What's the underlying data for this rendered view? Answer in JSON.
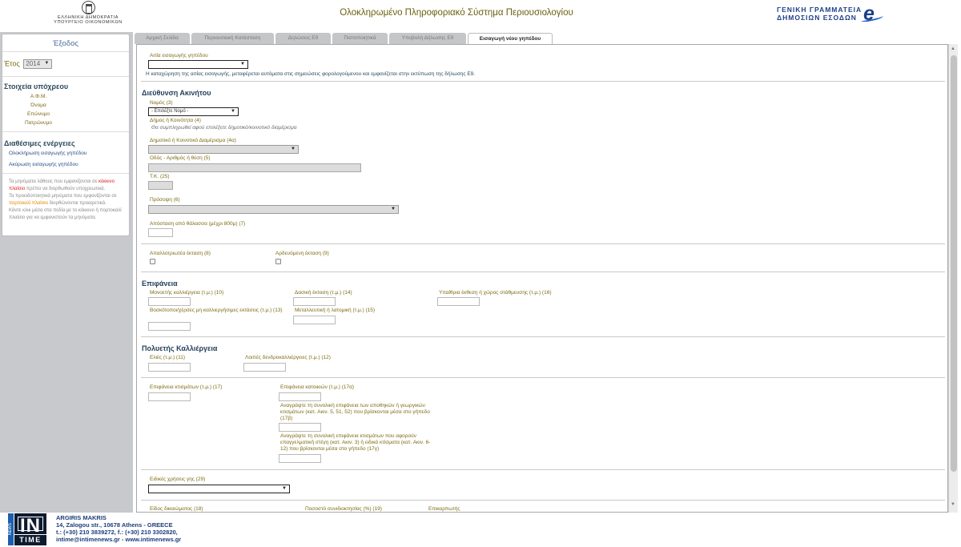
{
  "header": {
    "crest_line1": "ΕΛΛΗΝΙΚΗ ΔΗΜΟΚΡΑΤΙΑ",
    "crest_line2": "ΥΠΟΥΡΓΕΙΟ ΟΙΚΟΝΟΜΙΚΩΝ",
    "app_title": "Ολοκληρωμένο Πληροφοριακό Σύστημα Περιουσιολογίου",
    "org_line1": "ΓΕΝΙΚΗ ΓΡΑΜΜΑΤΕΙΑ",
    "org_line2": "ΔΗΜΟΣΙΩΝ ΕΣΟΔΩΝ",
    "org_logo": "e"
  },
  "sidebar": {
    "logout": "Έξοδος",
    "year_label": "Έτος",
    "year_value": "2014",
    "obligor_title": "Στοιχεία υπόχρεου",
    "obligor_fields": [
      "Α.Φ.Μ.",
      "Όνομα",
      "Επώνυμο",
      "Πατρώνυμο"
    ],
    "actions_title": "Διαθέσιμες ενέργειες",
    "action_complete": "Ολοκλήρωση εισαγωγής γηπέδου",
    "action_cancel": "Ακύρωση εισαγωγής γηπέδου",
    "note1_a": "Τα μηνύματα λάθους που εμφανίζονται σε ",
    "note1_red": "κόκκινο πλαίσιο",
    "note1_b": " πρέπει να διορθωθούν υποχρεωτικά.",
    "note2_a": "Τα προειδοποιητικά μηνύματα που εμφανίζονται σε ",
    "note2_orange": "πορτοκαλί πλαίσιο",
    "note2_b": " διορθώνονται προαιρετικά.",
    "note3": "Κάντε κλικ μέσα στα πεδία με το κόκκινο ή πορτοκαλί πλαίσιο για να εμφανιστούν τα μηνύματα."
  },
  "tabs": [
    {
      "label": "Αρχική Σελίδα"
    },
    {
      "label": "Περιουσιακή Κατάσταση"
    },
    {
      "label": "Δηλώσεις Ε9"
    },
    {
      "label": "Πιστοποιητικά"
    },
    {
      "label": "Υποβολή Δήλωσης Ε9"
    },
    {
      "label": "Εισαγωγή νέου γηπέδου"
    }
  ],
  "form": {
    "entry_cause_label": "Αιτία εισαγωγής γηπέδου",
    "entry_cause_value": "",
    "entry_note": "Η καταχώρηση της αιτίας εισαγωγής, μεταφέρεται αυτόματα στις σημειώσεις φορολογούμενου και εμφανίζεται στην εκτύπωση της δήλωσης Ε9.",
    "address_title": "Διεύθυνση Ακινήτου",
    "prefecture_label": "Νομός (3)",
    "prefecture_value": "- Επιλέξτε Νομό -",
    "municipality_label": "Δήμος ή Κοινότητα (4)",
    "municipality_hint": "Θα συμπληρωθεί αφού επιλέξετε δημοτικό/κοινοτικό διαμέρισμα",
    "district_label": "Δημοτικό ή Κοινοτικό Διαμέρισμα (4α)",
    "street_label": "Οδός - Αριθμός ή θέση (5)",
    "postcode_label": "Τ.Κ. (25)",
    "frontage_label": "Πρόσοψη (6)",
    "sea_distance_label": "Απόσταση από θάλασσα (μέχρι 800μ) (7)",
    "expropriated_label": "Απαλλοτριωτέα έκταση (8)",
    "irrigated_label": "Αρδευόμενη έκταση (9)",
    "surface_title": "Επιφάνεια",
    "annual_crop_label": "Μονοετής καλλιέργεια (τ.μ.) (10)",
    "forest_label": "Δασική έκταση (τ.μ.) (14)",
    "outdoor_storage_label": "Υπαίθρια έκθεση ή χώρος στάθμευσης (τ.μ.) (16)",
    "pasture_label": "Βοσκότοποι/χέρσες μη καλλιεργήσιμες εκτάσεις (τ.μ.) (13)",
    "mine_label": "Μεταλλευτική ή λατομική (τ.μ.) (15)",
    "perennial_title": "Πολυετής Καλλιέργεια",
    "olives_label": "Ελιές (τ.μ.) (11)",
    "other_trees_label": "Λοιπές δενδροκαλλιέργειες (τ.μ.) (12)",
    "buildings_area_label": "Επιφάνεια κτισμάτων (τ.μ.) (17)",
    "residences_area_label": "Επιφάνεια κατοικιών (τ.μ.) (17α)",
    "storage_note_label": "Αναγράψτε τη συνολική επιφάνεια των αποθηκών ή γεωργικών κτισμάτων (κατ. Ακιν. 5, 51, 52) που βρίσκονται μέσα στο γήπεδο (17β)",
    "professional_note_label": "Αναγράψτε τη συνολική επιφάνεια κτισμάτων που αφορούν επαγγελματική στέγη (κατ. Ακιν. 3) ή ειδικά κτίσματα (κατ. Ακιν. 6-12) που βρίσκονται μέσα στο γήπεδο (17γ)",
    "special_use_label": "Ειδικές χρήσεις γης (29)",
    "right_type_label": "Είδος δικαιώματος (18)",
    "coownership_label": "Ποσοστό συνιδιοκτησίας (%) (19)",
    "usufruct_label": "Επικαρπωτής"
  },
  "footer": {
    "logo_main": "IN",
    "logo_sub": "TIME",
    "logo_side": "NEWS",
    "name": "ARGIRIS MAKRIS",
    "address": "14, Zalogou str., 10678 Athens - GREECE",
    "phones": "t.: (+30) 210 3839272, f.: (+30) 210 3302820,",
    "web": "intime@intimenews.gr  -  www.intimenews.gr"
  }
}
